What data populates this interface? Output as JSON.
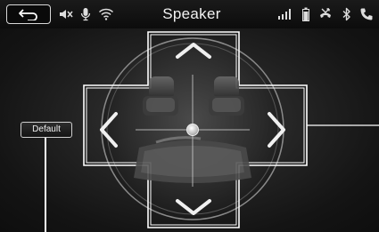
{
  "statusbar": {
    "title": "Speaker",
    "left_icons": [
      "back-arrow-icon",
      "mute-icon",
      "microphone-icon",
      "wifi-icon"
    ],
    "right_icons": [
      "signal-bars-icon",
      "battery-icon",
      "phone-missed-icon",
      "bluetooth-icon",
      "phone-icon"
    ]
  },
  "controls": {
    "default_label": "Default",
    "direction_buttons": [
      "up",
      "down",
      "left",
      "right"
    ],
    "balance_fader": "center"
  },
  "colors": {
    "background": "#1a1a1a",
    "foreground": "#f2f2f2",
    "outline": "#ffffff"
  }
}
